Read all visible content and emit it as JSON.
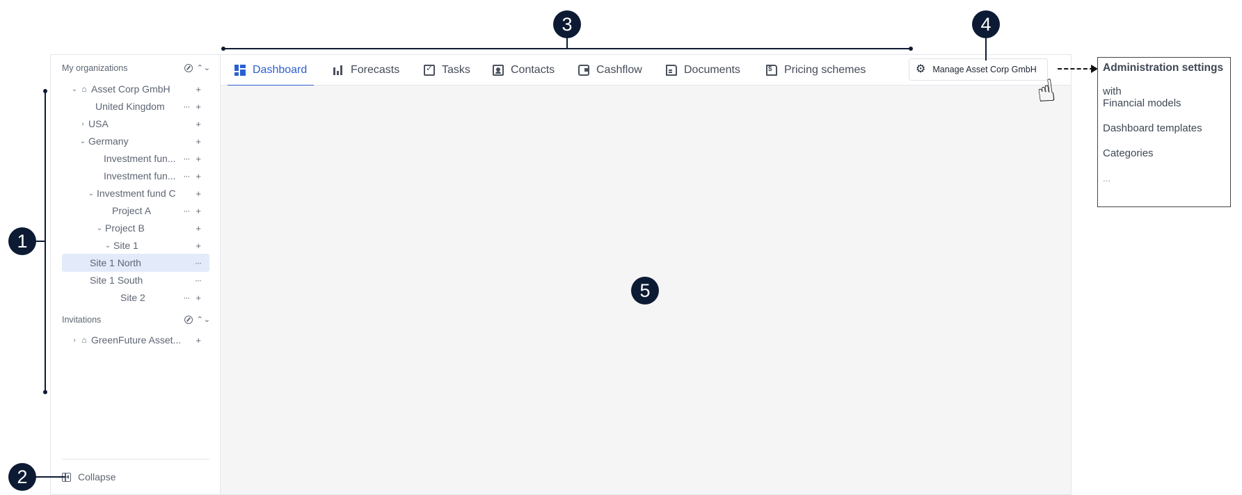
{
  "sidebar": {
    "organizations_label": "My organizations",
    "tree": [
      {
        "label": "Asset Corp GmbH",
        "caret": "⌄",
        "home": true,
        "dots": false,
        "plus": true
      },
      {
        "label": "United Kingdom",
        "caret": "",
        "home": false,
        "dots": true,
        "plus": true
      },
      {
        "label": "USA",
        "caret": "›",
        "home": false,
        "dots": false,
        "plus": true
      },
      {
        "label": "Germany",
        "caret": "⌄",
        "home": false,
        "dots": false,
        "plus": true
      },
      {
        "label": "Investment fun...",
        "caret": "",
        "home": false,
        "dots": true,
        "plus": true
      },
      {
        "label": "Investment fun...",
        "caret": "",
        "home": false,
        "dots": true,
        "plus": true
      },
      {
        "label": "Investment fund C",
        "caret": "⌄",
        "home": false,
        "dots": false,
        "plus": true
      },
      {
        "label": "Project A",
        "caret": "",
        "home": false,
        "dots": true,
        "plus": true
      },
      {
        "label": "Project B",
        "caret": "⌄",
        "home": false,
        "dots": false,
        "plus": true
      },
      {
        "label": "Site 1",
        "caret": "⌄",
        "home": false,
        "dots": false,
        "plus": true
      },
      {
        "label": "Site 1 North",
        "caret": "",
        "home": false,
        "dots": true,
        "plus": false,
        "selected": true
      },
      {
        "label": "Site 1 South",
        "caret": "",
        "home": false,
        "dots": true,
        "plus": false
      },
      {
        "label": "Site 2",
        "caret": "",
        "home": false,
        "dots": true,
        "plus": true
      }
    ],
    "invitations_label": "Invitations",
    "invitations": [
      {
        "label": "GreenFuture Asset...",
        "caret": "›",
        "home": true,
        "dots": false,
        "plus": true
      }
    ],
    "collapse_label": "Collapse",
    "plus_glyph": "+",
    "dots_glyph": "···",
    "home_glyph": "⌂",
    "updown_glyph": "⌃⌄"
  },
  "tabs": [
    {
      "label": "Dashboard",
      "icon": "dashboard-icon",
      "active": true
    },
    {
      "label": "Forecasts",
      "icon": "bar-chart-icon"
    },
    {
      "label": "Tasks",
      "icon": "task-check-icon"
    },
    {
      "label": "Contacts",
      "icon": "contact-book-icon"
    },
    {
      "label": "Cashflow",
      "icon": "wallet-icon"
    },
    {
      "label": "Documents",
      "icon": "document-icon"
    },
    {
      "label": "Pricing schemes",
      "icon": "pricing-doc-icon"
    }
  ],
  "manage_button": {
    "label": "Manage Asset Corp GmbH",
    "icon": "gear-icon"
  },
  "admin_popup": {
    "title": "Administration settings",
    "with": "with",
    "items": [
      "Financial models",
      "Dashboard templates",
      "Categories"
    ],
    "ellipsis": "..."
  },
  "callouts": [
    "1",
    "2",
    "3",
    "4",
    "5"
  ],
  "colors": {
    "accent": "#2c5fd3",
    "selected_row": "#e3ebfa",
    "callout": "#0d1a33",
    "content_bg": "#f5f5f6"
  }
}
